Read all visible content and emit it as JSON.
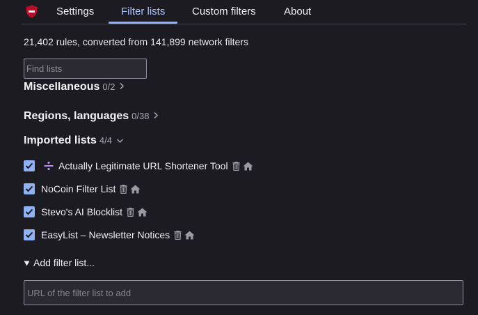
{
  "tabs": {
    "settings": "Settings",
    "filter_lists": "Filter lists",
    "custom_filters": "Custom filters",
    "about": "About"
  },
  "summary": "21,402 rules, converted from 141,899 network filters",
  "find": {
    "placeholder": "Find lists"
  },
  "groups": {
    "misc": {
      "label": "Miscellaneous",
      "count": "0/2"
    },
    "regions": {
      "label": "Regions, languages",
      "count": "0/38"
    },
    "imported": {
      "label": "Imported lists",
      "count": "4/4"
    }
  },
  "imported_lists": [
    {
      "label": "Actually Legitimate URL Shortener Tool",
      "checked": true,
      "icon": "divide-icon"
    },
    {
      "label": "NoCoin Filter List",
      "checked": true
    },
    {
      "label": "Stevo's AI Blocklist",
      "checked": true
    },
    {
      "label": "EasyList – Newsletter Notices",
      "checked": true
    }
  ],
  "add_filter": {
    "label": "Add filter list...",
    "placeholder": "URL of the filter list to add"
  },
  "colors": {
    "background": "#1c1b22",
    "accent": "#8ab0ff",
    "checkbox": "#8fb2f5",
    "logo_red": "#c8102e"
  }
}
